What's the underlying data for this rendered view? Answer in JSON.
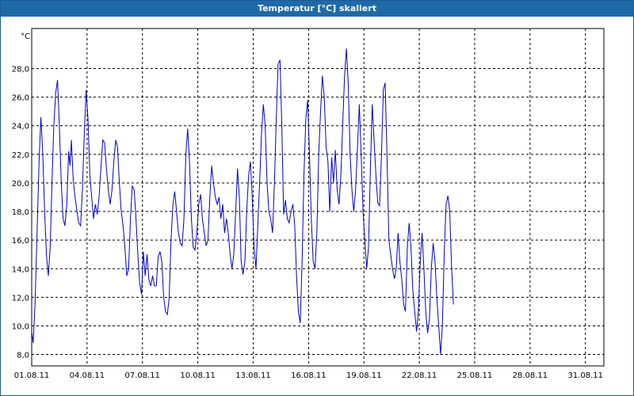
{
  "window": {
    "title": "Temperatur [°C] skaliert"
  },
  "chart_data": {
    "type": "line",
    "title": "Temperatur [°C] skaliert",
    "ylabel": "°C",
    "xlabel": "",
    "ylim": [
      7.2,
      30.8
    ],
    "xlim": [
      0,
      31
    ],
    "grid": true,
    "yticks": [
      8,
      10,
      12,
      14,
      16,
      18,
      20,
      22,
      24,
      26,
      28
    ],
    "ytick_labels": [
      "8,0",
      "10,0",
      "12,0",
      "14,0",
      "16,0",
      "18,0",
      "20,0",
      "22,0",
      "24,0",
      "26,0",
      "28,0"
    ],
    "xticks": [
      0,
      3,
      6,
      9,
      12,
      15,
      18,
      21,
      24,
      27,
      30
    ],
    "xtick_labels": [
      "01.08.11",
      "04.08.11",
      "07.08.11",
      "10.08.11",
      "13.08.11",
      "16.08.11",
      "19.08.11",
      "22.08.11",
      "25.08.11",
      "28.08.11",
      "31.08.11"
    ],
    "line_color": "#0000cc",
    "series": [
      {
        "name": "",
        "points": [
          [
            0.0,
            9.6
          ],
          [
            0.08,
            8.8
          ],
          [
            0.18,
            11.5
          ],
          [
            0.3,
            17.0
          ],
          [
            0.4,
            21.5
          ],
          [
            0.5,
            24.6
          ],
          [
            0.6,
            22.0
          ],
          [
            0.7,
            18.0
          ],
          [
            0.8,
            15.0
          ],
          [
            0.9,
            13.5
          ],
          [
            1.0,
            15.5
          ],
          [
            1.1,
            20.0
          ],
          [
            1.2,
            24.0
          ],
          [
            1.3,
            26.3
          ],
          [
            1.4,
            27.2
          ],
          [
            1.5,
            24.0
          ],
          [
            1.6,
            20.0
          ],
          [
            1.7,
            17.5
          ],
          [
            1.8,
            17.0
          ],
          [
            1.9,
            18.5
          ],
          [
            2.0,
            22.2
          ],
          [
            2.08,
            21.2
          ],
          [
            2.15,
            23.0
          ],
          [
            2.25,
            20.2
          ],
          [
            2.35,
            19.0
          ],
          [
            2.45,
            18.0
          ],
          [
            2.55,
            17.2
          ],
          [
            2.65,
            17.0
          ],
          [
            2.75,
            19.5
          ],
          [
            2.85,
            23.5
          ],
          [
            2.95,
            26.5
          ],
          [
            3.05,
            24.5
          ],
          [
            3.15,
            20.5
          ],
          [
            3.25,
            19.0
          ],
          [
            3.35,
            17.5
          ],
          [
            3.45,
            18.5
          ],
          [
            3.55,
            17.8
          ],
          [
            3.65,
            19.0
          ],
          [
            3.75,
            21.0
          ],
          [
            3.85,
            23.0
          ],
          [
            3.95,
            22.8
          ],
          [
            4.05,
            21.0
          ],
          [
            4.15,
            19.5
          ],
          [
            4.25,
            18.5
          ],
          [
            4.35,
            19.5
          ],
          [
            4.45,
            21.5
          ],
          [
            4.55,
            23.0
          ],
          [
            4.65,
            22.5
          ],
          [
            4.75,
            20.0
          ],
          [
            4.85,
            18.0
          ],
          [
            4.95,
            17.0
          ],
          [
            5.05,
            15.5
          ],
          [
            5.15,
            13.5
          ],
          [
            5.25,
            14.0
          ],
          [
            5.35,
            17.5
          ],
          [
            5.45,
            19.8
          ],
          [
            5.55,
            19.5
          ],
          [
            5.65,
            17.5
          ],
          [
            5.75,
            15.0
          ],
          [
            5.85,
            13.0
          ],
          [
            5.95,
            12.2
          ],
          [
            6.05,
            15.2
          ],
          [
            6.15,
            13.5
          ],
          [
            6.25,
            15.0
          ],
          [
            6.35,
            13.2
          ],
          [
            6.45,
            12.8
          ],
          [
            6.55,
            13.5
          ],
          [
            6.65,
            12.8
          ],
          [
            6.75,
            12.8
          ],
          [
            6.85,
            14.8
          ],
          [
            6.95,
            15.2
          ],
          [
            7.05,
            14.5
          ],
          [
            7.15,
            12.0
          ],
          [
            7.25,
            11.0
          ],
          [
            7.35,
            10.8
          ],
          [
            7.45,
            12.0
          ],
          [
            7.55,
            16.0
          ],
          [
            7.65,
            18.5
          ],
          [
            7.75,
            19.4
          ],
          [
            7.85,
            18.0
          ],
          [
            7.95,
            16.5
          ],
          [
            8.05,
            15.8
          ],
          [
            8.15,
            15.6
          ],
          [
            8.25,
            17.5
          ],
          [
            8.35,
            22.0
          ],
          [
            8.45,
            23.8
          ],
          [
            8.55,
            21.5
          ],
          [
            8.65,
            17.5
          ],
          [
            8.75,
            15.5
          ],
          [
            8.85,
            15.3
          ],
          [
            8.95,
            16.5
          ],
          [
            9.05,
            18.5
          ],
          [
            9.15,
            19.2
          ],
          [
            9.25,
            17.5
          ],
          [
            9.35,
            16.5
          ],
          [
            9.45,
            15.6
          ],
          [
            9.55,
            16.0
          ],
          [
            9.65,
            19.0
          ],
          [
            9.75,
            21.2
          ],
          [
            9.85,
            20.0
          ],
          [
            9.95,
            19.0
          ],
          [
            10.05,
            18.5
          ],
          [
            10.15,
            19.0
          ],
          [
            10.25,
            17.5
          ],
          [
            10.35,
            18.5
          ],
          [
            10.45,
            16.5
          ],
          [
            10.55,
            17.5
          ],
          [
            10.65,
            16.5
          ],
          [
            10.75,
            15.0
          ],
          [
            10.85,
            14.0
          ],
          [
            10.95,
            15.0
          ],
          [
            11.05,
            18.0
          ],
          [
            11.15,
            21.0
          ],
          [
            11.25,
            19.0
          ],
          [
            11.35,
            14.5
          ],
          [
            11.45,
            13.6
          ],
          [
            11.55,
            14.5
          ],
          [
            11.65,
            18.0
          ],
          [
            11.75,
            20.5
          ],
          [
            11.85,
            21.5
          ],
          [
            11.95,
            19.0
          ],
          [
            12.05,
            15.5
          ],
          [
            12.15,
            14.0
          ],
          [
            12.25,
            17.0
          ],
          [
            12.35,
            20.0
          ],
          [
            12.45,
            23.5
          ],
          [
            12.55,
            25.5
          ],
          [
            12.65,
            24.0
          ],
          [
            12.75,
            20.0
          ],
          [
            12.85,
            18.0
          ],
          [
            12.95,
            17.5
          ],
          [
            13.05,
            16.5
          ],
          [
            13.15,
            20.0
          ],
          [
            13.25,
            24.5
          ],
          [
            13.35,
            28.3
          ],
          [
            13.45,
            28.6
          ],
          [
            13.55,
            24.0
          ],
          [
            13.65,
            17.8
          ],
          [
            13.75,
            18.8
          ],
          [
            13.85,
            17.5
          ],
          [
            13.95,
            17.2
          ],
          [
            14.05,
            18.0
          ],
          [
            14.15,
            18.5
          ],
          [
            14.25,
            17.0
          ],
          [
            14.35,
            13.5
          ],
          [
            14.45,
            11.0
          ],
          [
            14.55,
            10.2
          ],
          [
            14.65,
            14.5
          ],
          [
            14.75,
            20.5
          ],
          [
            14.85,
            24.5
          ],
          [
            14.95,
            25.8
          ],
          [
            15.05,
            22.0
          ],
          [
            15.15,
            17.5
          ],
          [
            15.25,
            14.5
          ],
          [
            15.35,
            14.0
          ],
          [
            15.45,
            16.5
          ],
          [
            15.55,
            22.0
          ],
          [
            15.65,
            25.0
          ],
          [
            15.75,
            27.5
          ],
          [
            15.85,
            26.0
          ],
          [
            15.95,
            22.5
          ],
          [
            16.05,
            21.5
          ],
          [
            16.15,
            18.0
          ],
          [
            16.25,
            21.8
          ],
          [
            16.35,
            20.0
          ],
          [
            16.45,
            22.3
          ],
          [
            16.55,
            19.5
          ],
          [
            16.65,
            18.5
          ],
          [
            16.75,
            20.5
          ],
          [
            16.85,
            24.0
          ],
          [
            16.95,
            27.5
          ],
          [
            17.05,
            29.4
          ],
          [
            17.15,
            27.0
          ],
          [
            17.25,
            22.0
          ],
          [
            17.35,
            19.5
          ],
          [
            17.45,
            18.0
          ],
          [
            17.55,
            19.5
          ],
          [
            17.65,
            22.5
          ],
          [
            17.75,
            25.5
          ],
          [
            17.85,
            22.0
          ],
          [
            17.95,
            18.0
          ],
          [
            18.05,
            16.0
          ],
          [
            18.15,
            14.0
          ],
          [
            18.25,
            15.5
          ],
          [
            18.35,
            21.0
          ],
          [
            18.45,
            25.5
          ],
          [
            18.55,
            23.0
          ],
          [
            18.65,
            20.5
          ],
          [
            18.75,
            18.6
          ],
          [
            18.85,
            18.4
          ],
          [
            18.95,
            22.0
          ],
          [
            19.05,
            26.5
          ],
          [
            19.15,
            27.0
          ],
          [
            19.25,
            22.0
          ],
          [
            19.35,
            16.0
          ],
          [
            19.45,
            15.0
          ],
          [
            19.55,
            14.0
          ],
          [
            19.65,
            13.3
          ],
          [
            19.75,
            14.0
          ],
          [
            19.85,
            16.5
          ],
          [
            19.95,
            14.5
          ],
          [
            20.05,
            13.2
          ],
          [
            20.15,
            11.5
          ],
          [
            20.25,
            11.0
          ],
          [
            20.35,
            15.5
          ],
          [
            20.45,
            17.2
          ],
          [
            20.55,
            15.5
          ],
          [
            20.65,
            12.5
          ],
          [
            20.75,
            11.0
          ],
          [
            20.85,
            9.6
          ],
          [
            20.95,
            11.0
          ],
          [
            21.05,
            14.5
          ],
          [
            21.15,
            16.5
          ],
          [
            21.25,
            14.0
          ],
          [
            21.35,
            11.0
          ],
          [
            21.45,
            9.5
          ],
          [
            21.55,
            10.5
          ],
          [
            21.65,
            14.0
          ],
          [
            21.75,
            15.8
          ],
          [
            21.85,
            14.5
          ],
          [
            21.95,
            12.0
          ],
          [
            22.05,
            10.0
          ],
          [
            22.15,
            8.0
          ],
          [
            22.25,
            10.0
          ],
          [
            22.35,
            15.0
          ],
          [
            22.45,
            18.5
          ],
          [
            22.55,
            19.1
          ],
          [
            22.65,
            18.0
          ],
          [
            22.75,
            14.0
          ],
          [
            22.85,
            11.5
          ]
        ]
      }
    ]
  }
}
